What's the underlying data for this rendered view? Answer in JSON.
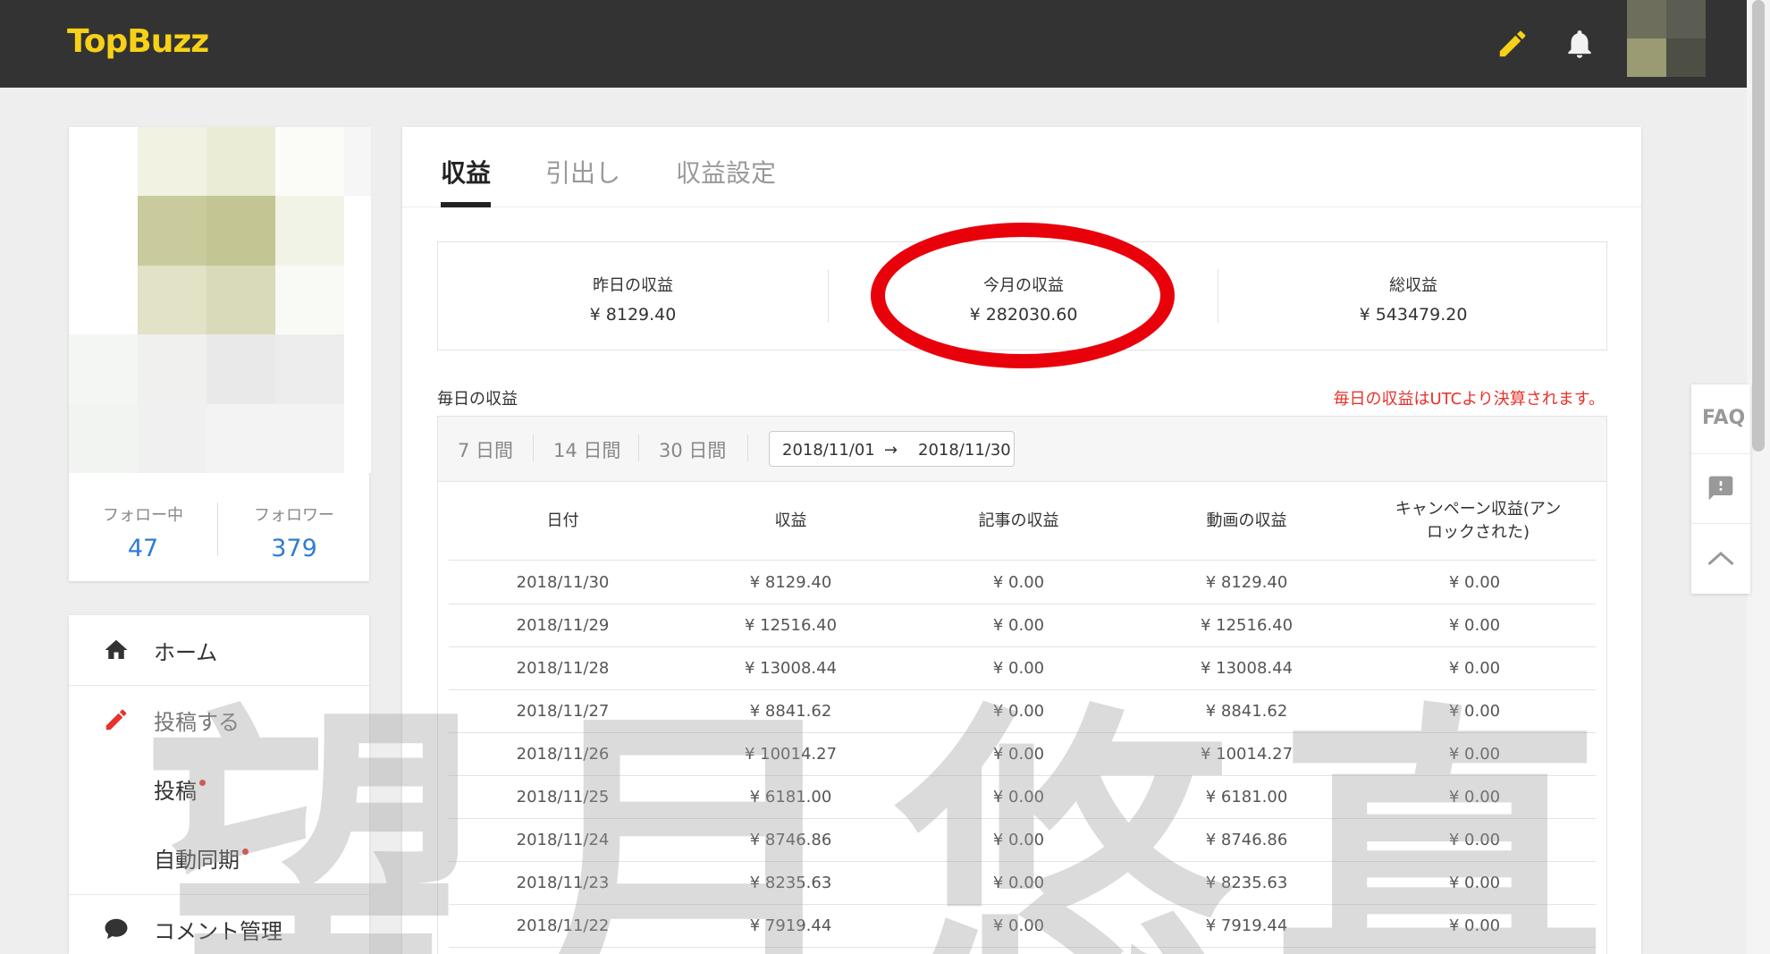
{
  "header": {
    "logo": "TopBuzz",
    "icons": [
      "pencil-icon",
      "bell-icon"
    ],
    "colors": {
      "bg": "#333333",
      "logo": "#f7d117",
      "accent": "#2f7cd3",
      "alert": "#e8322b"
    }
  },
  "profile": {
    "following_label": "フォロー中",
    "following_count": "47",
    "followers_label": "フォロワー",
    "followers_count": "379"
  },
  "nav": {
    "home": "ホーム",
    "post_section": "投稿する",
    "post": "投稿",
    "auto_sync": "自動同期",
    "comments": "コメント管理"
  },
  "tabs": [
    "収益",
    "引出し",
    "収益設定"
  ],
  "summary": {
    "yesterday_label": "昨日の収益",
    "yesterday_value": "¥ 8129.40",
    "month_label": "今月の収益",
    "month_value": "¥ 282030.60",
    "total_label": "総収益",
    "total_value": "¥ 543479.20"
  },
  "daily": {
    "title": "毎日の収益",
    "note": "毎日の収益はUTCより決算されます。",
    "periods": [
      "7 日間",
      "14 日間",
      "30 日間"
    ],
    "date_from": "2018/11/01",
    "arrow": "→",
    "date_to": "2018/11/30"
  },
  "table": {
    "columns": [
      "日付",
      "収益",
      "記事の収益",
      "動画の収益",
      "キャンペーン収益(アンロックされた)"
    ],
    "rows": [
      [
        "2018/11/30",
        "¥ 8129.40",
        "¥ 0.00",
        "¥ 8129.40",
        "¥ 0.00"
      ],
      [
        "2018/11/29",
        "¥ 12516.40",
        "¥ 0.00",
        "¥ 12516.40",
        "¥ 0.00"
      ],
      [
        "2018/11/28",
        "¥ 13008.44",
        "¥ 0.00",
        "¥ 13008.44",
        "¥ 0.00"
      ],
      [
        "2018/11/27",
        "¥ 8841.62",
        "¥ 0.00",
        "¥ 8841.62",
        "¥ 0.00"
      ],
      [
        "2018/11/26",
        "¥ 10014.27",
        "¥ 0.00",
        "¥ 10014.27",
        "¥ 0.00"
      ],
      [
        "2018/11/25",
        "¥ 6181.00",
        "¥ 0.00",
        "¥ 6181.00",
        "¥ 0.00"
      ],
      [
        "2018/11/24",
        "¥ 8746.86",
        "¥ 0.00",
        "¥ 8746.86",
        "¥ 0.00"
      ],
      [
        "2018/11/23",
        "¥ 8235.63",
        "¥ 0.00",
        "¥ 8235.63",
        "¥ 0.00"
      ],
      [
        "2018/11/22",
        "¥ 7919.44",
        "¥ 0.00",
        "¥ 7919.44",
        "¥ 0.00"
      ]
    ]
  },
  "watermark": "望月悠真",
  "side_tools": {
    "faq": "FAQ"
  }
}
